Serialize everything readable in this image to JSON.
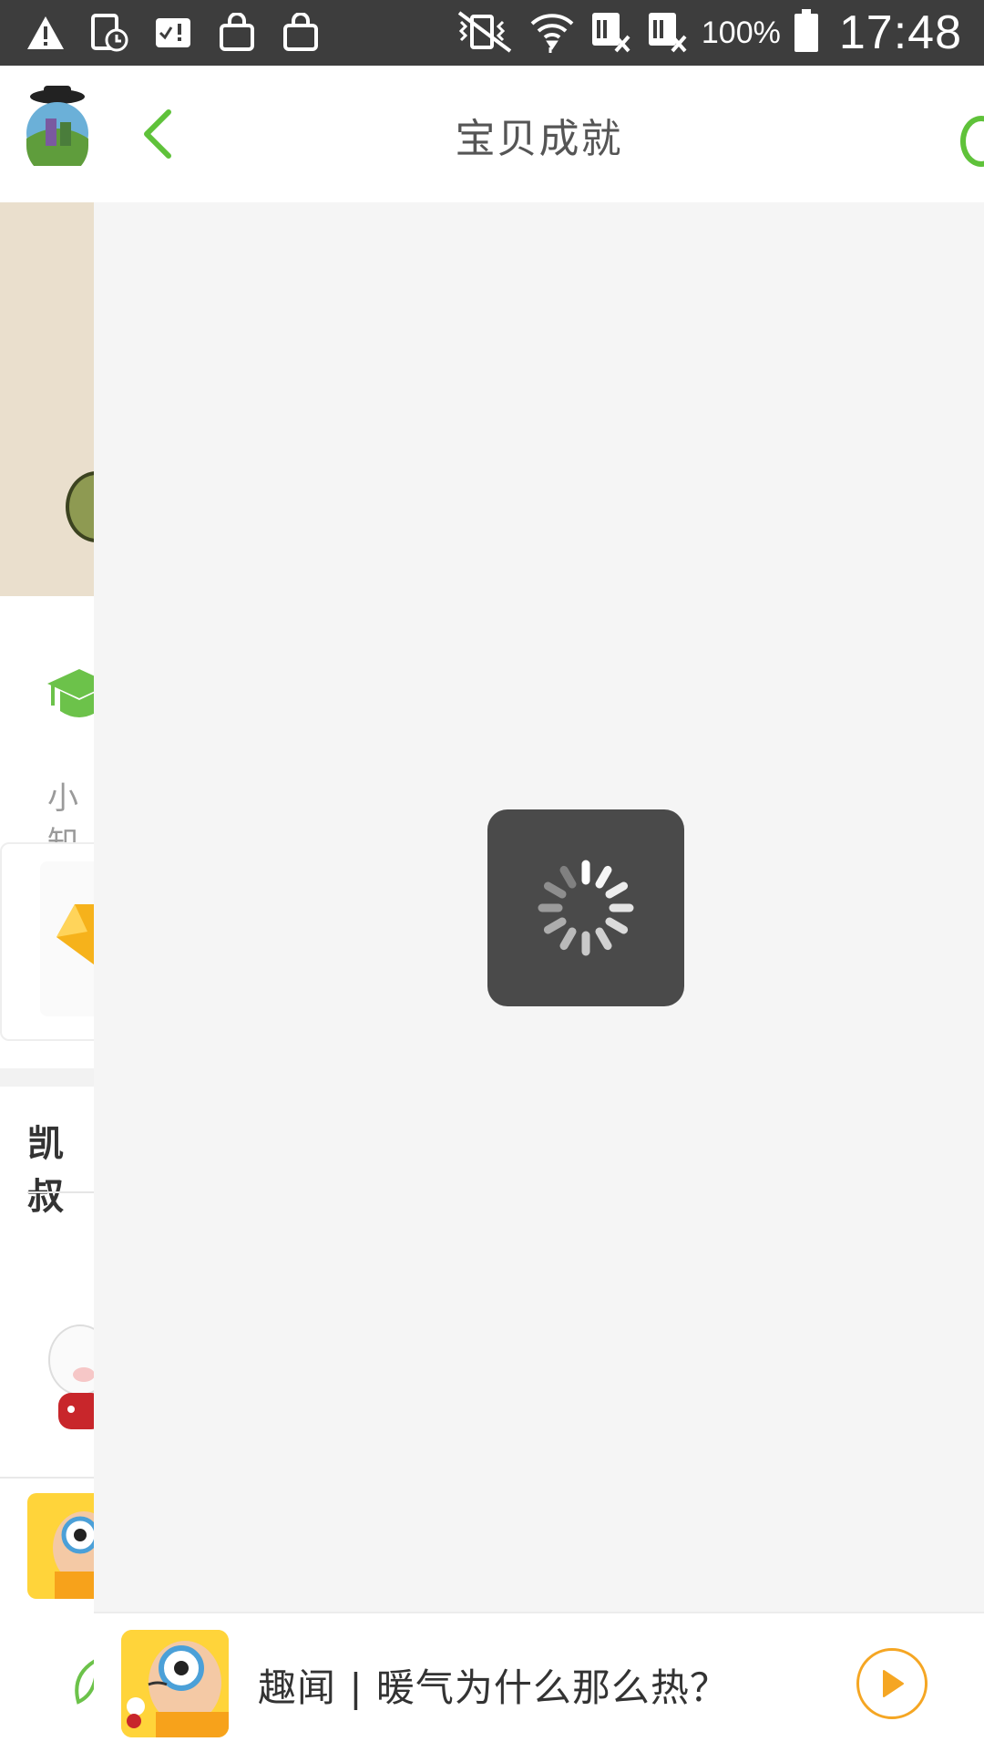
{
  "status_bar": {
    "left_icons": [
      "warning-icon",
      "clock-icon",
      "checklist-icon",
      "bag-icon",
      "bag-icon"
    ],
    "right_icons": [
      "vibrate-icon",
      "wifi-icon",
      "sim-off-icon",
      "sim-off-icon",
      "battery-icon"
    ],
    "battery": "100%",
    "time": "17:48"
  },
  "header": {
    "title": "宝贝成就",
    "back_icon": "chevron-left-icon",
    "accent_color": "#5fc23a"
  },
  "background_page": {
    "section_label": "小知",
    "section_title": "凯叔"
  },
  "loading": {
    "visible": true,
    "icon": "spinner-icon"
  },
  "player": {
    "title": "趣闻 | 暖气为什么那么热？",
    "play_icon": "play-icon",
    "accent_color": "#f5a623"
  }
}
